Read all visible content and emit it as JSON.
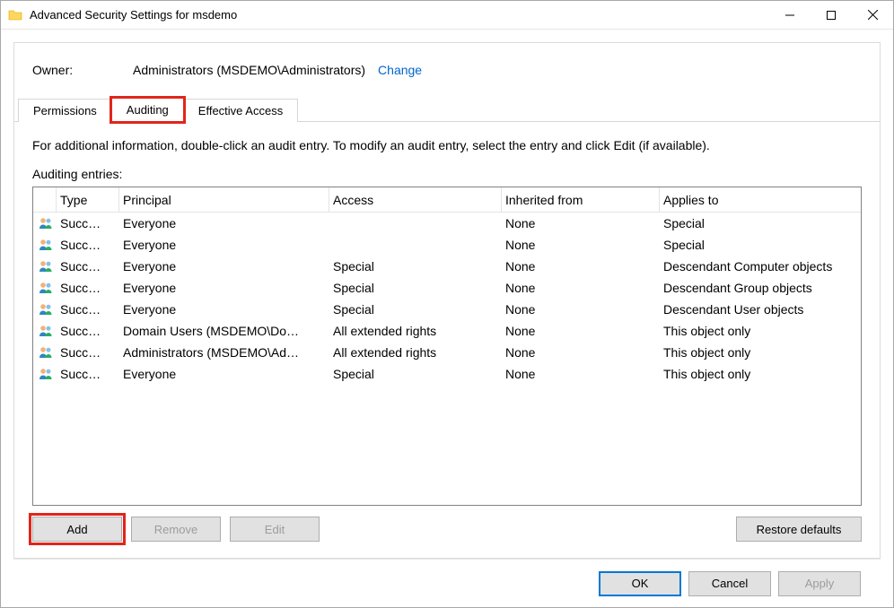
{
  "window": {
    "title": "Advanced Security Settings for msdemo"
  },
  "owner": {
    "label": "Owner:",
    "value": "Administrators (MSDEMO\\Administrators)",
    "change": "Change"
  },
  "tabs": {
    "permissions": "Permissions",
    "auditing": "Auditing",
    "effective_access": "Effective Access"
  },
  "info_text": "For additional information, double-click an audit entry. To modify an audit entry, select the entry and click Edit (if available).",
  "list_label": "Auditing entries:",
  "columns": {
    "type": "Type",
    "principal": "Principal",
    "access": "Access",
    "inherited": "Inherited from",
    "applies": "Applies to"
  },
  "entries": [
    {
      "type": "Succ…",
      "principal": "Everyone",
      "access": "",
      "inherited": "None",
      "applies": "Special"
    },
    {
      "type": "Succ…",
      "principal": "Everyone",
      "access": "",
      "inherited": "None",
      "applies": "Special"
    },
    {
      "type": "Succ…",
      "principal": "Everyone",
      "access": "Special",
      "inherited": "None",
      "applies": "Descendant Computer objects"
    },
    {
      "type": "Succ…",
      "principal": "Everyone",
      "access": "Special",
      "inherited": "None",
      "applies": "Descendant Group objects"
    },
    {
      "type": "Succ…",
      "principal": "Everyone",
      "access": "Special",
      "inherited": "None",
      "applies": "Descendant User objects"
    },
    {
      "type": "Succ…",
      "principal": "Domain Users (MSDEMO\\Do…",
      "access": "All extended rights",
      "inherited": "None",
      "applies": "This object only"
    },
    {
      "type": "Succ…",
      "principal": "Administrators (MSDEMO\\Ad…",
      "access": "All extended rights",
      "inherited": "None",
      "applies": "This object only"
    },
    {
      "type": "Succ…",
      "principal": "Everyone",
      "access": "Special",
      "inherited": "None",
      "applies": "This object only"
    }
  ],
  "buttons": {
    "add": "Add",
    "remove": "Remove",
    "edit": "Edit",
    "restore": "Restore defaults",
    "ok": "OK",
    "cancel": "Cancel",
    "apply": "Apply"
  }
}
